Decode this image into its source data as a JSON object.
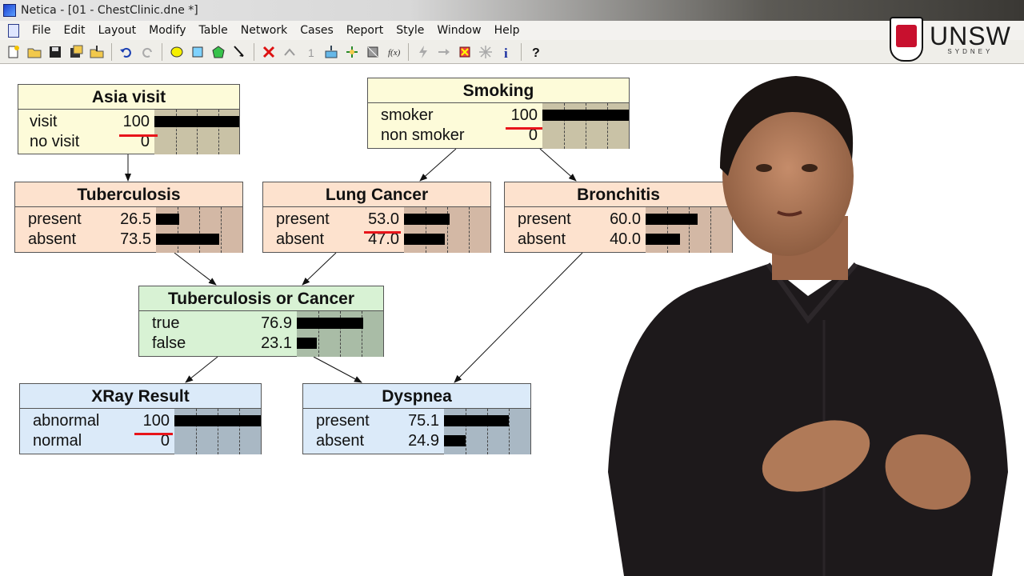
{
  "window": {
    "title": "Netica - [01 - ChestClinic.dne *]"
  },
  "menu": [
    "File",
    "Edit",
    "Layout",
    "Modify",
    "Table",
    "Network",
    "Cases",
    "Report",
    "Style",
    "Window",
    "Help"
  ],
  "toolbar": {
    "icons": [
      "new-icon",
      "open-icon",
      "save-icon",
      "save-as-icon",
      "import-icon",
      "undo-icon",
      "redo-icon",
      "nature-node-icon",
      "decision-node-icon",
      "utility-node-icon",
      "arrow-tool-icon",
      "delete-icon",
      "upward-icon",
      "number-icon",
      "compile-icon",
      "expand-icon",
      "structure-icon",
      "fx-icon",
      "lightning-icon",
      "arrow-right-icon",
      "remove-findings-icon",
      "absorb-icon",
      "info-icon",
      "help-icon"
    ]
  },
  "logo": {
    "main": "UNSW",
    "sub": "SYDNEY"
  },
  "nodes": {
    "asia": {
      "title": "Asia visit",
      "states": [
        {
          "label": "visit",
          "value": "100",
          "fraction": 1.0
        },
        {
          "label": "no visit",
          "value": "0",
          "fraction": 0.0
        }
      ]
    },
    "smoking": {
      "title": "Smoking",
      "states": [
        {
          "label": "smoker",
          "value": "100",
          "fraction": 1.0
        },
        {
          "label": "non smoker",
          "value": "0",
          "fraction": 0.0
        }
      ]
    },
    "tuberculosis": {
      "title": "Tuberculosis",
      "states": [
        {
          "label": "present",
          "value": "26.5",
          "fraction": 0.265
        },
        {
          "label": "absent",
          "value": "73.5",
          "fraction": 0.735
        }
      ]
    },
    "lung_cancer": {
      "title": "Lung Cancer",
      "states": [
        {
          "label": "present",
          "value": "53.0",
          "fraction": 0.53
        },
        {
          "label": "absent",
          "value": "47.0",
          "fraction": 0.47
        }
      ]
    },
    "bronchitis": {
      "title": "Bronchitis",
      "states": [
        {
          "label": "present",
          "value": "60.0",
          "fraction": 0.6
        },
        {
          "label": "absent",
          "value": "40.0",
          "fraction": 0.4
        }
      ]
    },
    "tb_or_cancer": {
      "title": "Tuberculosis or Cancer",
      "states": [
        {
          "label": "true",
          "value": "76.9",
          "fraction": 0.769
        },
        {
          "label": "false",
          "value": "23.1",
          "fraction": 0.231
        }
      ]
    },
    "xray": {
      "title": "XRay Result",
      "states": [
        {
          "label": "abnormal",
          "value": "100",
          "fraction": 1.0
        },
        {
          "label": "normal",
          "value": "0",
          "fraction": 0.0
        }
      ]
    },
    "dyspnea": {
      "title": "Dyspnea",
      "states": [
        {
          "label": "present",
          "value": "75.1",
          "fraction": 0.751
        },
        {
          "label": "absent",
          "value": "24.9",
          "fraction": 0.249
        }
      ]
    }
  },
  "colors": {
    "highlight": "#e8141a"
  }
}
